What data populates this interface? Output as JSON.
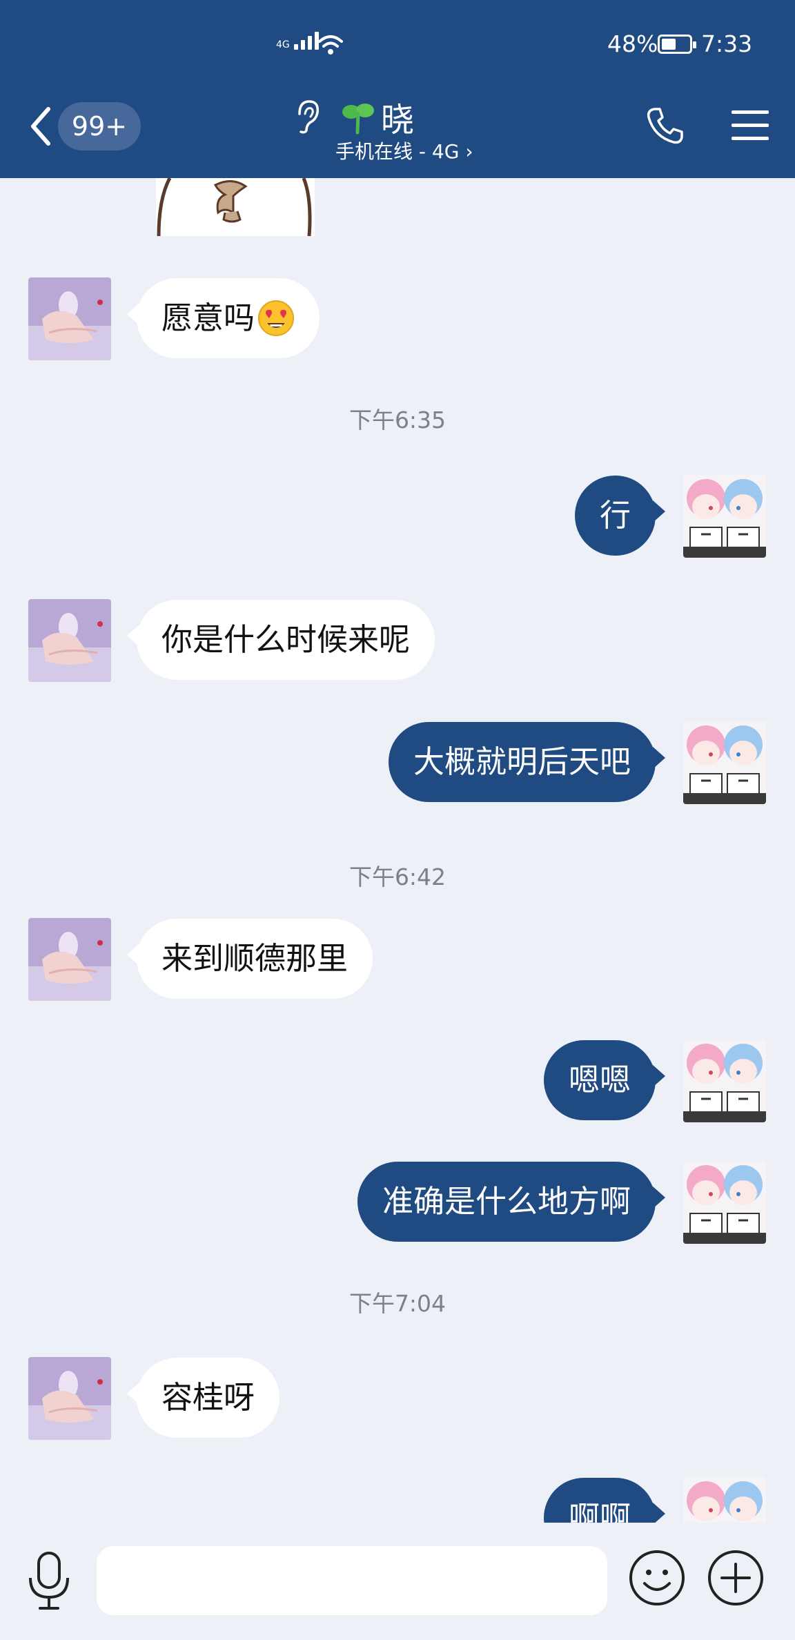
{
  "status_bar": {
    "network": "4G",
    "battery": "48%",
    "battery_level": 0.48,
    "time": "7:33"
  },
  "header": {
    "unread_count": "99+",
    "contact_name": "晓",
    "contact_status": "手机在线 - 4G ›"
  },
  "messages": [
    {
      "type": "in",
      "text": "愿意吗",
      "emoji": "heart-eyes-emoji"
    },
    {
      "type": "time",
      "text": "下午6:35"
    },
    {
      "type": "out",
      "text": "行"
    },
    {
      "type": "in",
      "text": "你是什么时候来呢"
    },
    {
      "type": "out",
      "text": "大概就明后天吧"
    },
    {
      "type": "time",
      "text": "下午6:42"
    },
    {
      "type": "in",
      "text": "来到顺德那里"
    },
    {
      "type": "out",
      "text": "嗯嗯"
    },
    {
      "type": "out",
      "text": "准确是什么地方啊"
    },
    {
      "type": "time",
      "text": "下午7:04"
    },
    {
      "type": "in",
      "text": "容桂呀"
    },
    {
      "type": "out",
      "text": "啊啊"
    }
  ],
  "input": {
    "placeholder": ""
  },
  "colors": {
    "header_bg": "#1f4a82",
    "chat_bg": "#eef0f7",
    "outgoing_bubble": "#1f4a82",
    "incoming_bubble": "#ffffff"
  }
}
